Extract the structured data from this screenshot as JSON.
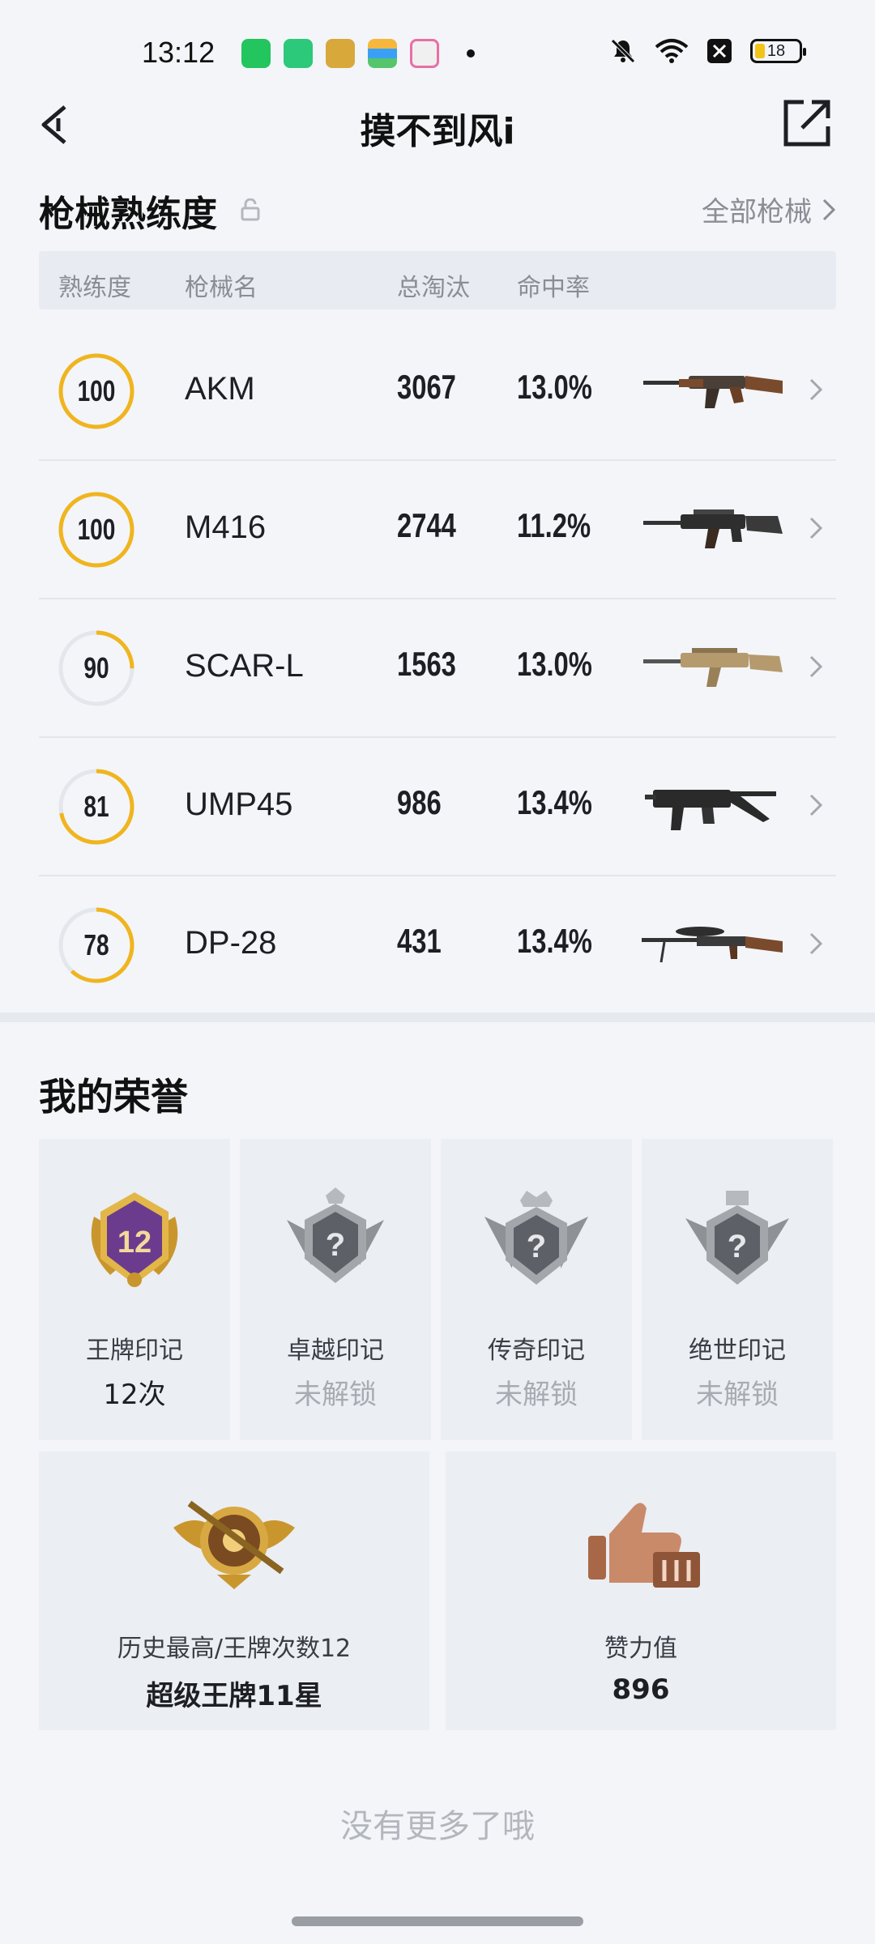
{
  "status": {
    "time": "13:12",
    "battery": "18"
  },
  "header": {
    "title": "摸不到风i"
  },
  "weapons_section": {
    "title": "枪械熟练度",
    "all_link": "全部枪械",
    "columns": [
      "熟练度",
      "枪械名",
      "总淘汰",
      "命中率"
    ],
    "rows": [
      {
        "level": "100",
        "name": "AKM",
        "kills": "3067",
        "accuracy": "13.0%",
        "progress": 1.0
      },
      {
        "level": "100",
        "name": "M416",
        "kills": "2744",
        "accuracy": "11.2%",
        "progress": 1.0
      },
      {
        "level": "90",
        "name": "SCAR-L",
        "kills": "1563",
        "accuracy": "13.0%",
        "progress": 0.25
      },
      {
        "level": "81",
        "name": "UMP45",
        "kills": "986",
        "accuracy": "13.4%",
        "progress": 0.72
      },
      {
        "level": "78",
        "name": "DP-28",
        "kills": "431",
        "accuracy": "13.4%",
        "progress": 0.62
      }
    ]
  },
  "honors": {
    "title": "我的荣誉",
    "badges": [
      {
        "name": "王牌印记",
        "value": "12次",
        "badge_number": "12"
      },
      {
        "name": "卓越印记",
        "value": "未解锁"
      },
      {
        "name": "传奇印记",
        "value": "未解锁"
      },
      {
        "name": "绝世印记",
        "value": "未解锁"
      }
    ],
    "stats": [
      {
        "label": "历史最高/王牌次数12",
        "value": "超级王牌11星"
      },
      {
        "label": "赞力值",
        "value": "896"
      }
    ]
  },
  "footer": {
    "no_more": "没有更多了哦"
  },
  "colors": {
    "ring": "#f0b51e",
    "ring_track": "#e3e6eb",
    "gold": "#c9962e",
    "bronze": "#b97a5a"
  }
}
